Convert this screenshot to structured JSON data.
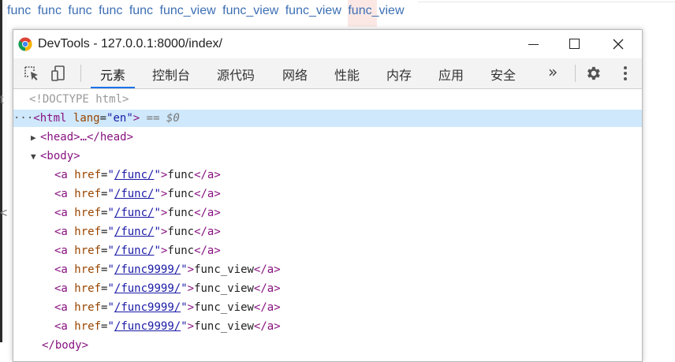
{
  "background": {
    "links": [
      "func",
      "func",
      "func",
      "func",
      "func",
      "func_view",
      "func_view",
      "func_view",
      "func_view"
    ],
    "frag1": "t",
    "frag2": "<"
  },
  "window": {
    "title": "DevTools - 127.0.0.1:8000/index/"
  },
  "toolbar": {
    "tabs": [
      {
        "label": "元素",
        "active": true
      },
      {
        "label": "控制台"
      },
      {
        "label": "源代码"
      },
      {
        "label": "网络"
      },
      {
        "label": "性能"
      },
      {
        "label": "内存"
      },
      {
        "label": "应用"
      },
      {
        "label": "安全"
      }
    ],
    "more": "»"
  },
  "elements": {
    "doctype": "<!DOCTYPE html>",
    "html_tag": "html",
    "html_attr": "lang",
    "html_val": "en",
    "selected_marker": "== $0",
    "head": "<head>…</head>",
    "body_open": "<body>",
    "body_close": "</body>",
    "anchors": [
      {
        "href": "/func/",
        "text": "func"
      },
      {
        "href": "/func/",
        "text": "func"
      },
      {
        "href": "/func/",
        "text": "func"
      },
      {
        "href": "/func/",
        "text": "func"
      },
      {
        "href": "/func/",
        "text": "func"
      },
      {
        "href": "/func9999/",
        "text": "func_view"
      },
      {
        "href": "/func9999/",
        "text": "func_view"
      },
      {
        "href": "/func9999/",
        "text": "func_view"
      },
      {
        "href": "/func9999/",
        "text": "func_view"
      }
    ]
  },
  "colors": {
    "tab_underline": "#1a73e8",
    "selected_row": "#cfe8fc",
    "tag": "#881280",
    "attribute": "#994500",
    "value": "#1a1aa6"
  }
}
